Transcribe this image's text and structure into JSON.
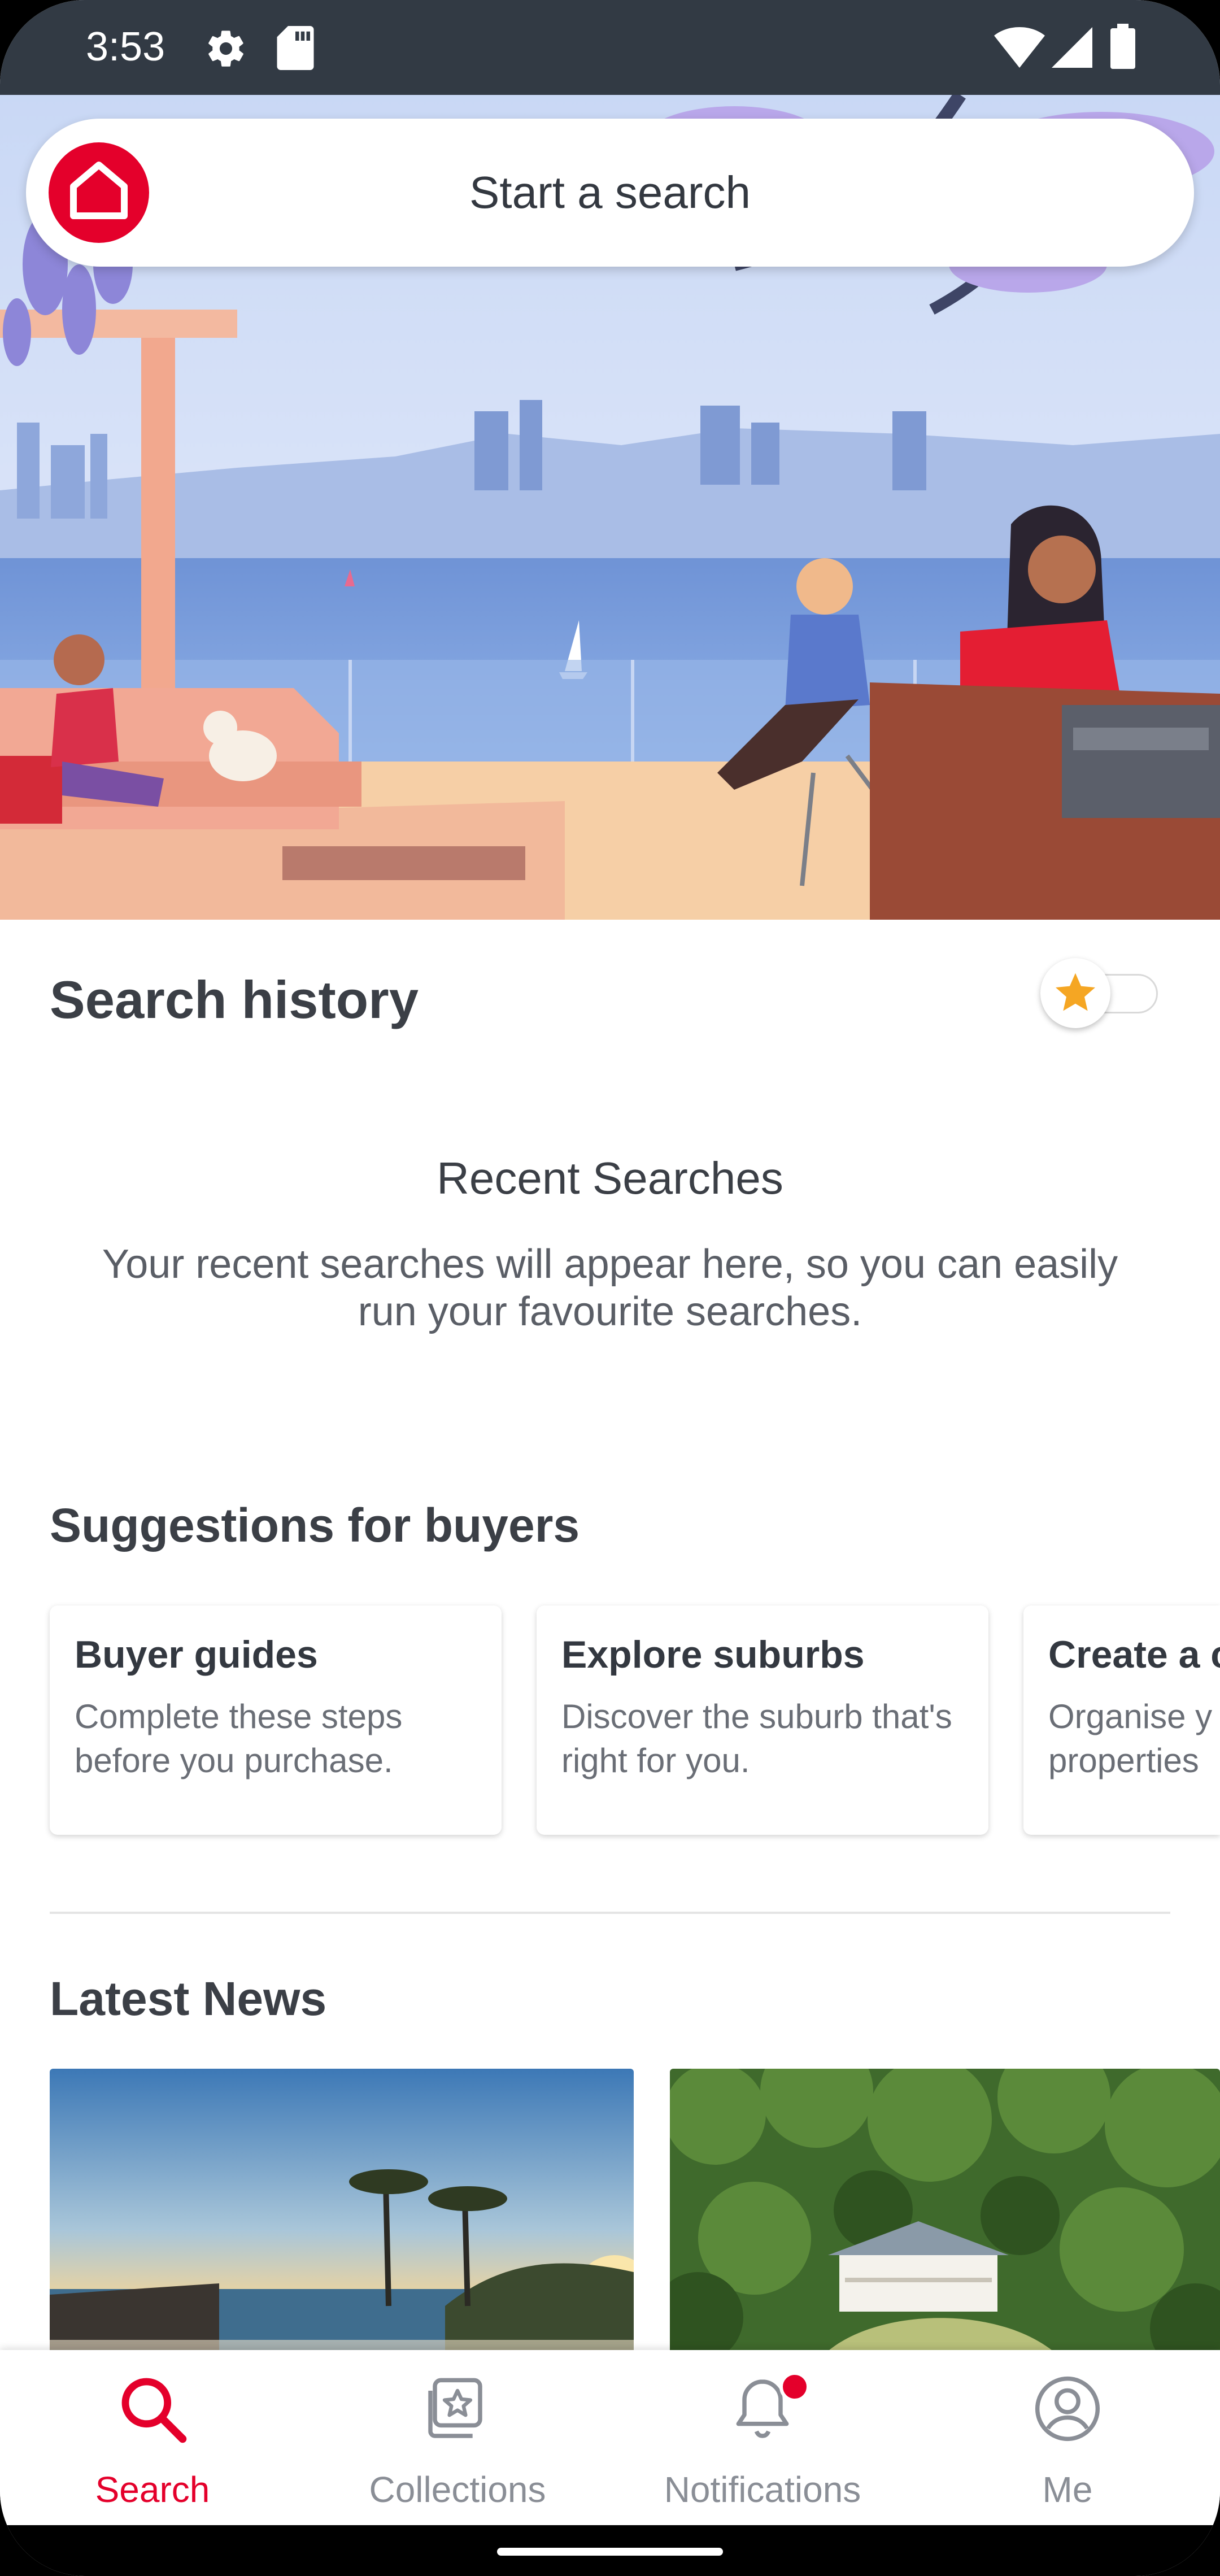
{
  "status_bar": {
    "time": "3:53",
    "icons": [
      "gear-icon",
      "sd-card-icon",
      "wifi-icon",
      "signal-icon",
      "battery-icon"
    ]
  },
  "search": {
    "placeholder": "Start a search",
    "logo_icon": "home-logo-icon"
  },
  "search_history": {
    "title": "Search history",
    "toggle_icon": "star-icon",
    "empty_title": "Recent Searches",
    "empty_description": "Your recent searches will appear here, so you can easily run your favourite searches."
  },
  "suggestions": {
    "title": "Suggestions for buyers",
    "cards": [
      {
        "title": "Buyer guides",
        "description": "Complete these steps before you purchase."
      },
      {
        "title": "Explore suburbs",
        "description": "Discover the suburb that's right for you."
      },
      {
        "title": "Create a c",
        "description_line1": "Organise y",
        "description_line2": "properties"
      }
    ]
  },
  "news": {
    "title": "Latest News",
    "items": [
      {
        "image": "beach-sunset-photo"
      },
      {
        "image": "country-house-photo"
      }
    ]
  },
  "bottom_nav": {
    "items": [
      {
        "label": "Search",
        "icon": "search-icon",
        "active": true
      },
      {
        "label": "Collections",
        "icon": "collections-icon",
        "active": false
      },
      {
        "label": "Notifications",
        "icon": "bell-icon",
        "active": false
      },
      {
        "label": "Me",
        "icon": "profile-icon",
        "active": false
      }
    ]
  },
  "colors": {
    "brand_red": "#e4002b",
    "status_bar": "#323a44",
    "text_dark": "#3b3f46",
    "star": "#f5a623"
  }
}
